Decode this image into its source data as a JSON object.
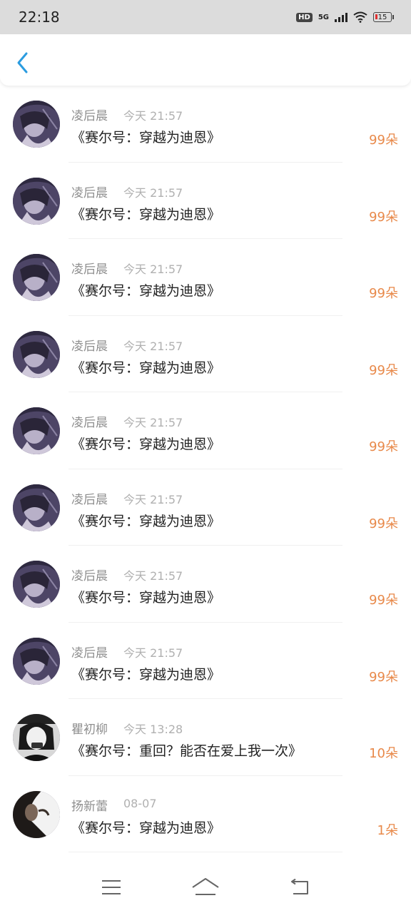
{
  "status_bar": {
    "time": "22:18",
    "hd_label": "HD",
    "network_label": "5G",
    "battery_level": "15"
  },
  "header": {
    "back_icon": "chevron-left-icon",
    "accent_color": "#2b9ce0"
  },
  "gifts": [
    {
      "name": "凌后晨",
      "time": "今天 21:57",
      "title": "《赛尔号：穿越为迪恩》",
      "amount": "99朵",
      "avatar": "anime-girl"
    },
    {
      "name": "凌后晨",
      "time": "今天 21:57",
      "title": "《赛尔号：穿越为迪恩》",
      "amount": "99朵",
      "avatar": "anime-girl"
    },
    {
      "name": "凌后晨",
      "time": "今天 21:57",
      "title": "《赛尔号：穿越为迪恩》",
      "amount": "99朵",
      "avatar": "anime-girl"
    },
    {
      "name": "凌后晨",
      "time": "今天 21:57",
      "title": "《赛尔号：穿越为迪恩》",
      "amount": "99朵",
      "avatar": "anime-girl"
    },
    {
      "name": "凌后晨",
      "time": "今天 21:57",
      "title": "《赛尔号：穿越为迪恩》",
      "amount": "99朵",
      "avatar": "anime-girl"
    },
    {
      "name": "凌后晨",
      "time": "今天 21:57",
      "title": "《赛尔号：穿越为迪恩》",
      "amount": "99朵",
      "avatar": "anime-girl"
    },
    {
      "name": "凌后晨",
      "time": "今天 21:57",
      "title": "《赛尔号：穿越为迪恩》",
      "amount": "99朵",
      "avatar": "anime-girl"
    },
    {
      "name": "凌后晨",
      "time": "今天 21:57",
      "title": "《赛尔号：穿越为迪恩》",
      "amount": "99朵",
      "avatar": "anime-girl"
    },
    {
      "name": "瞿初柳",
      "time": "今天 13:28",
      "title": "《赛尔号：重回？能否在爱上我一次》",
      "amount": "10朵",
      "avatar": "bw-girl"
    },
    {
      "name": "扬新蕾",
      "time": "08-07",
      "title": "《赛尔号：穿越为迪恩》",
      "amount": "1朵",
      "avatar": "dark-portrait"
    }
  ],
  "colors": {
    "amount": "#e8894a",
    "name": "#8f8f8f",
    "time": "#b0b0b0",
    "title": "#222222"
  },
  "nav": {
    "menu_icon": "menu-icon",
    "home_icon": "home-icon",
    "back_icon": "back-icon"
  }
}
